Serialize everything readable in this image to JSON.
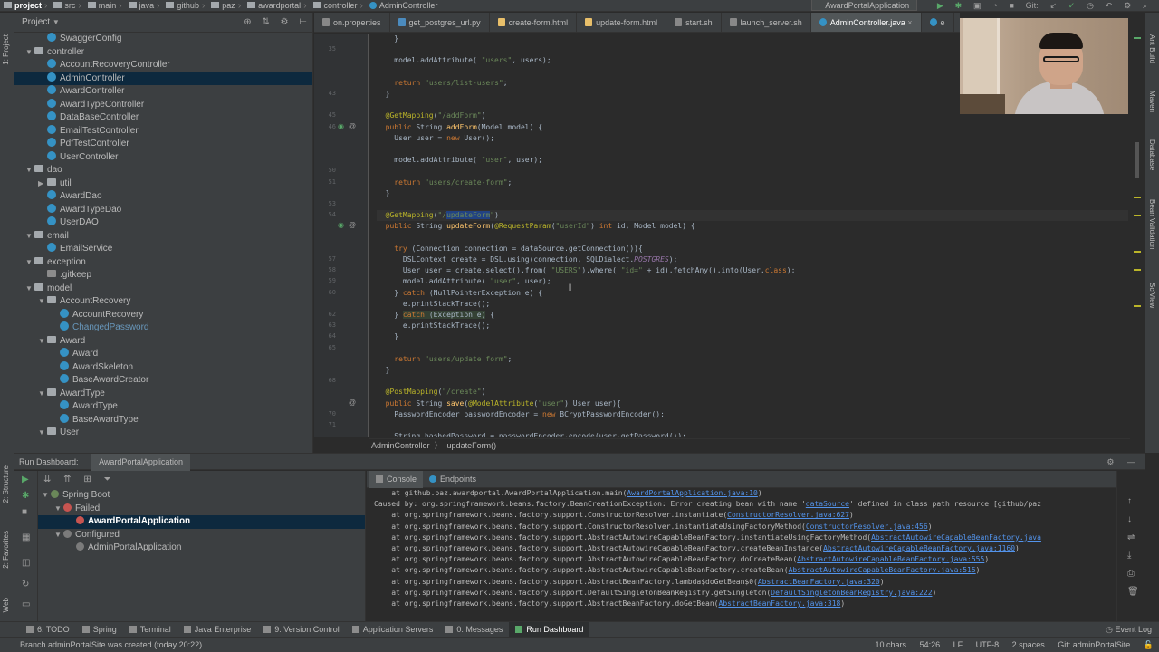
{
  "breadcrumbs": [
    "project",
    "src",
    "main",
    "java",
    "github",
    "paz",
    "awardportal",
    "controller",
    "AdminController"
  ],
  "toolbar": {
    "run_config": "AwardPortalApplication",
    "git_label": "Git:"
  },
  "project_panel": {
    "title": "Project",
    "tree": [
      {
        "label": "SwaggerConfig",
        "indent": 4,
        "icon": "c"
      },
      {
        "label": "controller",
        "indent": 3,
        "icon": "f",
        "arrow": "▼"
      },
      {
        "label": "AccountRecoveryController",
        "indent": 4,
        "icon": "c"
      },
      {
        "label": "AdminController",
        "indent": 4,
        "icon": "c",
        "selected": true
      },
      {
        "label": "AwardController",
        "indent": 4,
        "icon": "c"
      },
      {
        "label": "AwardTypeController",
        "indent": 4,
        "icon": "c"
      },
      {
        "label": "DataBaseController",
        "indent": 4,
        "icon": "c"
      },
      {
        "label": "EmailTestController",
        "indent": 4,
        "icon": "c"
      },
      {
        "label": "PdfTestController",
        "indent": 4,
        "icon": "c"
      },
      {
        "label": "UserController",
        "indent": 4,
        "icon": "c"
      },
      {
        "label": "dao",
        "indent": 3,
        "icon": "f",
        "arrow": "▼"
      },
      {
        "label": "util",
        "indent": 4,
        "icon": "f",
        "arrow": "▶"
      },
      {
        "label": "AwardDao",
        "indent": 4,
        "icon": "c"
      },
      {
        "label": "AwardTypeDao",
        "indent": 4,
        "icon": "c"
      },
      {
        "label": "UserDAO",
        "indent": 4,
        "icon": "c"
      },
      {
        "label": "email",
        "indent": 3,
        "icon": "f",
        "arrow": "▼"
      },
      {
        "label": "EmailService",
        "indent": 4,
        "icon": "c"
      },
      {
        "label": "exception",
        "indent": 3,
        "icon": "f",
        "arrow": "▼"
      },
      {
        "label": ".gitkeep",
        "indent": 4,
        "icon": "g"
      },
      {
        "label": "model",
        "indent": 3,
        "icon": "f",
        "arrow": "▼"
      },
      {
        "label": "AccountRecovery",
        "indent": 4,
        "icon": "f",
        "arrow": "▼"
      },
      {
        "label": "AccountRecovery",
        "indent": 5,
        "icon": "c"
      },
      {
        "label": "ChangedPassword",
        "indent": 5,
        "icon": "c",
        "changed": true
      },
      {
        "label": "Award",
        "indent": 4,
        "icon": "f",
        "arrow": "▼"
      },
      {
        "label": "Award",
        "indent": 5,
        "icon": "c"
      },
      {
        "label": "AwardSkeleton",
        "indent": 5,
        "icon": "c"
      },
      {
        "label": "BaseAwardCreator",
        "indent": 5,
        "icon": "c"
      },
      {
        "label": "AwardType",
        "indent": 4,
        "icon": "f",
        "arrow": "▼"
      },
      {
        "label": "AwardType",
        "indent": 5,
        "icon": "c"
      },
      {
        "label": "BaseAwardType",
        "indent": 5,
        "icon": "c"
      },
      {
        "label": "User",
        "indent": 4,
        "icon": "f",
        "arrow": "▼"
      }
    ]
  },
  "editor_tabs": [
    {
      "label": "on.properties",
      "icon": "s"
    },
    {
      "label": "get_postgres_url.py",
      "icon": "p"
    },
    {
      "label": "create-form.html",
      "icon": "h"
    },
    {
      "label": "update-form.html",
      "icon": "h"
    },
    {
      "label": "start.sh",
      "icon": "s"
    },
    {
      "label": "launch_server.sh",
      "icon": "s"
    },
    {
      "label": "AdminController.java",
      "icon": "c",
      "active": true
    },
    {
      "label": "e",
      "icon": "c"
    }
  ],
  "editor": {
    "line_numbers": [
      "",
      "35",
      "",
      "",
      "",
      "43",
      "",
      "45",
      "46",
      "",
      "",
      "",
      "50",
      "51",
      "",
      "53",
      "54",
      "",
      "",
      "",
      "57",
      "58",
      "59",
      "60",
      "",
      "62",
      "63",
      "64",
      "65",
      "",
      "",
      "68",
      "",
      "",
      "70",
      "71",
      "",
      "",
      ""
    ],
    "breadcrumb": [
      "AdminController",
      "updateForm()"
    ]
  },
  "code_lines": [
    "    }",
    "",
    "    model.addAttribute( \"users\", users);",
    "",
    "    return \"users/list-users\";",
    "  }",
    "",
    "  @GetMapping(\"/addForm\")",
    "  public String addForm(Model model) {",
    "    User user = new User();",
    "",
    "    model.addAttribute( \"user\", user);",
    "",
    "    return \"users/create-form\";",
    "  }",
    "",
    "  @GetMapping(\"/updateForm\")",
    "  public String updateForm(@RequestParam(\"userId\") int id, Model model) {",
    "",
    "    try (Connection connection = dataSource.getConnection()){",
    "      DSLContext create = DSL.using(connection, SQLDialect.POSTGRES);",
    "      User user = create.select().from( \"USERS\").where( \"id=\" + id).fetchAny().into(User.class);",
    "      model.addAttribute( \"user\", user);",
    "    } catch (NullPointerException e) {",
    "      e.printStackTrace();",
    "    } catch (Exception e) {",
    "      e.printStackTrace();",
    "    }",
    "",
    "    return \"users/update form\";",
    "  }",
    "",
    "  @PostMapping(\"/create\")",
    "  public String save(@ModelAttribute(\"user\") User user){",
    "    PasswordEncoder passwordEncoder = new BCryptPasswordEncoder();",
    "",
    "    String hashedPassword = passwordEncoder.encode(user.getPassword());"
  ],
  "run_dashboard": {
    "title": "Run Dashboard:",
    "tab": "AwardPortalApplication",
    "tree": [
      {
        "label": "Spring Boot",
        "indent": 0,
        "arrow": "▼",
        "icon": "leaf"
      },
      {
        "label": "Failed",
        "indent": 1,
        "arrow": "▼",
        "icon": "err"
      },
      {
        "label": "AwardPortalApplication",
        "indent": 2,
        "icon": "err",
        "selected": true
      },
      {
        "label": "Configured",
        "indent": 1,
        "arrow": "▼",
        "icon": "cfg"
      },
      {
        "label": "AdminPortalApplication",
        "indent": 2,
        "icon": "cfg"
      }
    ]
  },
  "console": {
    "tabs": [
      "Console",
      "Endpoints"
    ],
    "lines": [
      {
        "text": "    at github.paz.awardportal.AwardPortalApplication.main(",
        "link": "AwardPortalApplication.java:10",
        "after": ")"
      },
      {
        "text": "Caused by: org.springframework.beans.factory.BeanCreationException: Error creating bean with name '",
        "link": "dataSource",
        "after": "' defined in class path resource [github/paz"
      },
      {
        "text": "    at org.springframework.beans.factory.support.ConstructorResolver.instantiate(",
        "link": "ConstructorResolver.java:627",
        "after": ")"
      },
      {
        "text": "    at org.springframework.beans.factory.support.ConstructorResolver.instantiateUsingFactoryMethod(",
        "link": "ConstructorResolver.java:456",
        "after": ")"
      },
      {
        "text": "    at org.springframework.beans.factory.support.AbstractAutowireCapableBeanFactory.instantiateUsingFactoryMethod(",
        "link": "AbstractAutowireCapableBeanFactory.java",
        "after": ""
      },
      {
        "text": "    at org.springframework.beans.factory.support.AbstractAutowireCapableBeanFactory.createBeanInstance(",
        "link": "AbstractAutowireCapableBeanFactory.java:1160",
        "after": ")"
      },
      {
        "text": "    at org.springframework.beans.factory.support.AbstractAutowireCapableBeanFactory.doCreateBean(",
        "link": "AbstractAutowireCapableBeanFactory.java:555",
        "after": ")"
      },
      {
        "text": "    at org.springframework.beans.factory.support.AbstractAutowireCapableBeanFactory.createBean(",
        "link": "AbstractAutowireCapableBeanFactory.java:515",
        "after": ")"
      },
      {
        "text": "    at org.springframework.beans.factory.support.AbstractBeanFactory.lambda$doGetBean$0(",
        "link": "AbstractBeanFactory.java:320",
        "after": ")"
      },
      {
        "text": "    at org.springframework.beans.factory.support.DefaultSingletonBeanRegistry.getSingleton(",
        "link": "DefaultSingletonBeanRegistry.java:222",
        "after": ")"
      },
      {
        "text": "    at org.springframework.beans.factory.support.AbstractBeanFactory.doGetBean(",
        "link": "AbstractBeanFactory.java:318",
        "after": ")"
      }
    ]
  },
  "tool_windows": [
    {
      "label": "6: TODO"
    },
    {
      "label": "Spring"
    },
    {
      "label": "Terminal"
    },
    {
      "label": "Java Enterprise"
    },
    {
      "label": "9: Version Control"
    },
    {
      "label": "Application Servers"
    },
    {
      "label": "0: Messages"
    },
    {
      "label": "Run Dashboard",
      "active": true
    }
  ],
  "event_log": "Event Log",
  "status": {
    "message": "Branch adminPortalSite was created (today 20:22)",
    "chars": "10 chars",
    "position": "54:26",
    "line_sep": "LF",
    "encoding": "UTF-8",
    "indent": "2 spaces",
    "git": "Git: adminPortalSite"
  },
  "side_tabs": {
    "left": [
      "1: Project",
      "2: Structure",
      "2: Favorites",
      "Web"
    ],
    "right": [
      "Ant Build",
      "Maven",
      "Database",
      "Bean Validation",
      "SciView"
    ]
  }
}
